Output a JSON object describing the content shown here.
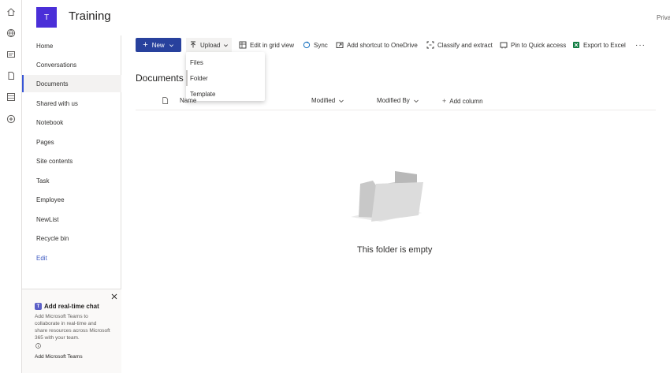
{
  "site": {
    "logo_letter": "T",
    "title": "Training",
    "privacy_label": "Priva",
    "logo_color": "#4a2fd8"
  },
  "app_rail": {
    "icons": [
      "home-icon",
      "globe-icon",
      "news-icon",
      "document-icon",
      "list-icon",
      "add-circle-icon"
    ]
  },
  "nav": {
    "items": [
      {
        "label": "Home"
      },
      {
        "label": "Conversations"
      },
      {
        "label": "Documents",
        "active": true
      },
      {
        "label": "Shared with us"
      },
      {
        "label": "Notebook"
      },
      {
        "label": "Pages"
      },
      {
        "label": "Site contents"
      },
      {
        "label": "Task"
      },
      {
        "label": "Employee"
      },
      {
        "label": "NewList"
      },
      {
        "label": "Recycle bin"
      }
    ],
    "edit_label": "Edit"
  },
  "chat_card": {
    "title": "Add real-time chat",
    "description": "Add Microsoft Teams to collaborate in real-time and share resources across Microsoft 365 with your team.",
    "link_label": "Add Microsoft Teams"
  },
  "toolbar": {
    "new_label": "New",
    "upload_label": "Upload",
    "grid_label": "Edit in grid view",
    "sync_label": "Sync",
    "shortcut_label": "Add shortcut to OneDrive",
    "classify_label": "Classify and extract",
    "pin_label": "Pin to Quick access",
    "export_label": "Export to Excel",
    "more_label": "···",
    "accent_color": "#28419d"
  },
  "upload_menu": {
    "items": [
      "Files",
      "Folder",
      "Template"
    ]
  },
  "library": {
    "title": "Documents",
    "columns": {
      "name": "Name",
      "modified": "Modified",
      "modified_by": "Modified By",
      "add_column": "Add column"
    },
    "empty_message": "This folder is empty"
  }
}
